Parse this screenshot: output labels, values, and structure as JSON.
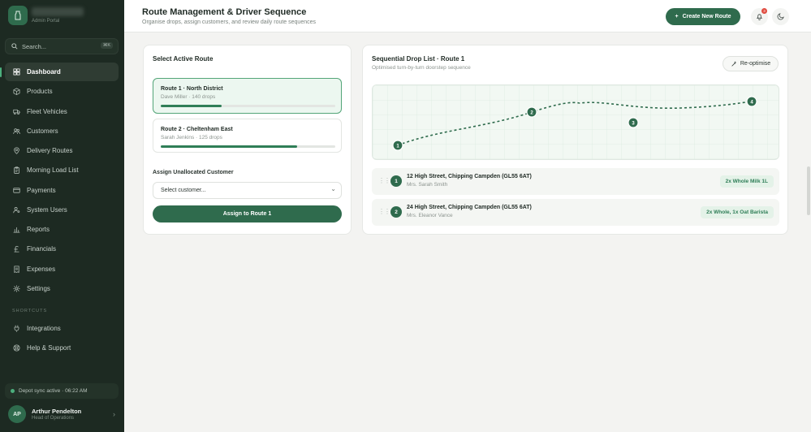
{
  "app": {
    "subtitle": "Admin Portal"
  },
  "sidebar": {
    "search_placeholder": "Search...",
    "search_shortcut": "⌘K",
    "items": [
      {
        "label": "Dashboard",
        "icon": "grid-icon"
      },
      {
        "label": "Products",
        "icon": "box-icon"
      },
      {
        "label": "Fleet Vehicles",
        "icon": "truck-icon"
      },
      {
        "label": "Customers",
        "icon": "users-icon"
      },
      {
        "label": "Delivery Routes",
        "icon": "map-pin-icon"
      },
      {
        "label": "Morning Load List",
        "icon": "clipboard-icon"
      },
      {
        "label": "Payments",
        "icon": "credit-card-icon"
      },
      {
        "label": "System Users",
        "icon": "user-cog-icon"
      },
      {
        "label": "Reports",
        "icon": "bar-chart-icon"
      },
      {
        "label": "Financials",
        "icon": "pound-icon"
      },
      {
        "label": "Expenses",
        "icon": "receipt-icon"
      },
      {
        "label": "Settings",
        "icon": "gear-icon"
      }
    ],
    "shortcuts_label": "SHORTCUTS",
    "shortcuts": [
      {
        "label": "Integrations",
        "icon": "plug-icon"
      },
      {
        "label": "Help & Support",
        "icon": "lifebuoy-icon"
      }
    ],
    "sync_status": "Depot sync active · 06:22 AM",
    "user": {
      "initials": "AP",
      "name": "Arthur Pendelton",
      "role": "Head of Operations"
    }
  },
  "header": {
    "title": "Route Management & Driver Sequence",
    "subtitle": "Organise drops, assign customers, and review daily route sequences",
    "create_button": "Create New Route",
    "notification_count": "3"
  },
  "routes_panel": {
    "title": "Select Active Route",
    "routes": [
      {
        "name": "Route 1 · North District",
        "driver_info": "Dave Miller · 140 drops",
        "progress": 0.35
      },
      {
        "name": "Route 2 · Cheltenham East",
        "driver_info": "Sarah Jenkins · 125 drops",
        "progress": 0.78
      }
    ],
    "assign_label": "Assign Unallocated Customer",
    "select_value": "Select customer...",
    "assign_button": "Assign to Route 1"
  },
  "drop_panel": {
    "title": "Sequential Drop List · Route 1",
    "subtitle": "Optimised turn-by-turn doorstep sequence",
    "reoptimise_button": "Re-optimise",
    "map_markers": [
      "1",
      "2",
      "3",
      "4"
    ],
    "drops": [
      {
        "number": "1",
        "address": "12 High Street, Chipping Campden (GL55 6AT)",
        "customer": "Mrs. Sarah Smith",
        "order": "2x Whole Milk 1L"
      },
      {
        "number": "2",
        "address": "24 High Street, Chipping Campden (GL55 6AT)",
        "customer": "Mrs. Eleanor Vance",
        "order": "2x Whole, 1x Oat Barista"
      }
    ]
  },
  "colors": {
    "sidebar_bg": "#1d2a22",
    "accent": "#2f6b4d",
    "accent_light": "#ecf7f0",
    "badge": "#e04a3f"
  }
}
